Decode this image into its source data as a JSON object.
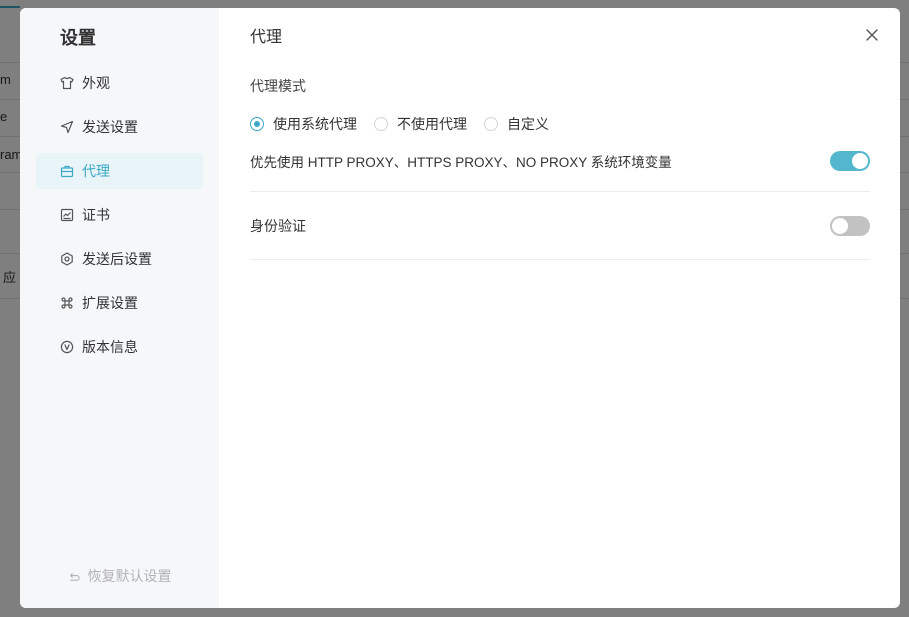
{
  "background_page": {
    "fragments": [
      "m",
      "e",
      "ram",
      "应"
    ]
  },
  "dialog": {
    "sidebar": {
      "title": "设置",
      "items": [
        {
          "label": "外观",
          "icon": "shirt-icon",
          "active": false
        },
        {
          "label": "发送设置",
          "icon": "send-icon",
          "active": false
        },
        {
          "label": "代理",
          "icon": "briefcase-icon",
          "active": true
        },
        {
          "label": "证书",
          "icon": "certificate-icon",
          "active": false
        },
        {
          "label": "发送后设置",
          "icon": "hexagon-settings-icon",
          "active": false
        },
        {
          "label": "扩展设置",
          "icon": "command-icon",
          "active": false
        },
        {
          "label": "版本信息",
          "icon": "version-icon",
          "active": false
        }
      ],
      "reset": {
        "label": "恢复默认设置",
        "icon": "undo-icon"
      }
    },
    "content": {
      "title": "代理",
      "close_icon": "close-icon",
      "proxy_mode": {
        "label": "代理模式",
        "options": [
          {
            "label": "使用系统代理",
            "checked": true
          },
          {
            "label": "不使用代理",
            "checked": false
          },
          {
            "label": "自定义",
            "checked": false
          }
        ]
      },
      "env_proxy": {
        "label": "优先使用 HTTP PROXY、HTTPS PROXY、NO PROXY 系统环境变量",
        "enabled": true
      },
      "auth": {
        "label": "身份验证",
        "enabled": false
      }
    }
  },
  "colors": {
    "accent": "#3ba9c6",
    "toggle_on": "#55b7ce",
    "toggle_off": "#c2c2c2",
    "sidebar_bg": "#f5f7f9",
    "active_item_bg": "#e8f4f8"
  }
}
